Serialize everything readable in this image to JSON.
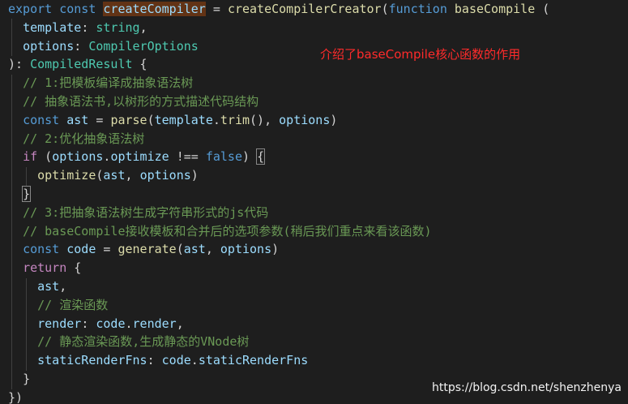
{
  "code": {
    "l1": {
      "export": "export",
      "const": "const",
      "name": "createCompiler",
      "eq": " = ",
      "creator": "createCompilerCreator",
      "paren": "(",
      "function": "function",
      "base": "baseCompile",
      "open": " ("
    },
    "l2": {
      "param": "template",
      "colon": ": ",
      "type": "string",
      "comma": ","
    },
    "l3": {
      "param": "options",
      "colon": ": ",
      "type": "CompilerOptions"
    },
    "l4": {
      "close": "): ",
      "type": "CompiledResult",
      "brace": " {"
    },
    "l5": "// 1:把模板编译成抽象语法树",
    "l6": "// 抽象语法书,以树形的方式描述代码结构",
    "l7": {
      "const": "const",
      "var": "ast",
      "eq": " = ",
      "fn": "parse",
      "p1": "(",
      "arg": "template",
      "dot": ".",
      "method": "trim",
      "p2": "(), ",
      "opt": "options",
      "p3": ")"
    },
    "l8": "// 2:优化抽象语法树",
    "l9": {
      "if": "if",
      "p1": " (",
      "opt": "options",
      "dot": ".",
      "prop": "optimize",
      "neq": " !== ",
      "false": "false",
      "p2": ") ",
      "brace": "{"
    },
    "l10": {
      "fn": "optimize",
      "p1": "(",
      "ast": "ast",
      "comma": ", ",
      "opt": "options",
      "p2": ")"
    },
    "l11": "}",
    "l12": "// 3:把抽象语法树生成字符串形式的js代码",
    "l13": "// baseCompile接收模板和合并后的选项参数(稍后我们重点来看该函数)",
    "l14": {
      "const": "const",
      "var": "code",
      "eq": " = ",
      "fn": "generate",
      "p1": "(",
      "ast": "ast",
      "comma": ", ",
      "opt": "options",
      "p2": ")"
    },
    "l15": {
      "return": "return",
      "brace": " {"
    },
    "l16": {
      "prop": "ast",
      "comma": ","
    },
    "l17": "// 渲染函数",
    "l18": {
      "prop": "render",
      "colon": ": ",
      "obj": "code",
      "dot": ".",
      "val": "render",
      "comma": ","
    },
    "l19": "// 静态渲染函数,生成静态的VNode树",
    "l20": {
      "prop": "staticRenderFns",
      "colon": ": ",
      "obj": "code",
      "dot": ".",
      "val": "staticRenderFns"
    },
    "l21": "}",
    "l22": "})"
  },
  "annotation": "介绍了baseCompile核心函数的作用",
  "watermark": "https://blog.csdn.net/shenzhenya",
  "colors": {
    "background": "#1e1e1e",
    "keyword": "#569cd6",
    "control": "#c586c0",
    "function": "#dcdcaa",
    "variable": "#9cdcfe",
    "type": "#4ec9b0",
    "comment": "#6a9955",
    "annotation": "#ff2b2b",
    "selection": "#623315"
  }
}
